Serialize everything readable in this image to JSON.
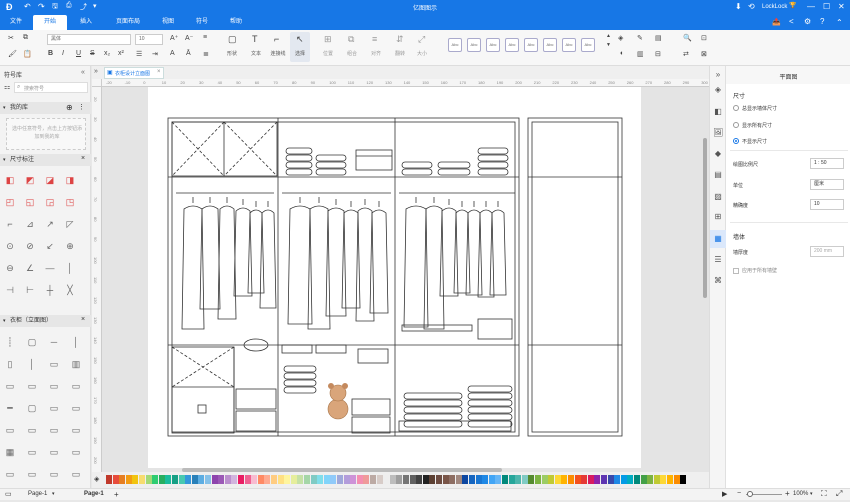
{
  "app": {
    "title": "亿图图示",
    "logo_glyph": "Ð",
    "quick": {
      "undo": "↶",
      "redo": "↷",
      "save": "🖫",
      "print": "⎙",
      "export": "⤴",
      "more": "▾"
    },
    "top_right": {
      "download": "⬇",
      "share": "⟲",
      "user_label": "LockLock",
      "gift": "🏆",
      "min": "—",
      "max": "☐",
      "close": "✕"
    }
  },
  "menu": {
    "items": [
      "文件",
      "开始",
      "插入",
      "页面布局",
      "视图",
      "符号",
      "帮助"
    ],
    "active_index": 1,
    "right_icons": {
      "publish": "📤",
      "share": "<",
      "settings": "⚙",
      "help": "?",
      "collapse": "⌃"
    }
  },
  "ribbon": {
    "font": "黑体",
    "size": "10",
    "tools": [
      {
        "label": "形状",
        "icon": "▢"
      },
      {
        "label": "文本",
        "icon": "T"
      },
      {
        "label": "连接线",
        "icon": "⌐"
      },
      {
        "label": "选择",
        "icon": "↖"
      }
    ],
    "tools2": [
      {
        "label": "位置",
        "icon": "⊞"
      },
      {
        "label": "组合",
        "icon": "⧉"
      },
      {
        "label": "对齐",
        "icon": "≡"
      },
      {
        "label": "翻转",
        "icon": "⇵"
      },
      {
        "label": "大小",
        "icon": "⤢"
      }
    ],
    "style_label": "Abc",
    "style_count": 8
  },
  "library": {
    "title": "符号库",
    "search_placeholder": "搜索符号",
    "my_library": "我的库",
    "my_library_hint": "选中任意符号，点击上方按钮添加到我的库",
    "section1": "尺寸标注",
    "section2": "衣柜（立面图）"
  },
  "canvas": {
    "tab": "衣柜设计立面图",
    "ruler_top": [
      "-20",
      "-10",
      "0",
      "10",
      "20",
      "30",
      "40",
      "50",
      "60",
      "70",
      "80",
      "90",
      "100",
      "110",
      "120",
      "130",
      "140",
      "150",
      "160",
      "170",
      "180",
      "190",
      "200",
      "210",
      "220",
      "230",
      "240",
      "250",
      "260",
      "270",
      "280",
      "290",
      "300"
    ],
    "ruler_left": [
      "20",
      "30",
      "40",
      "50",
      "60",
      "70",
      "80",
      "90",
      "100",
      "110",
      "120",
      "130",
      "140",
      "150",
      "160",
      "170",
      "180",
      "190",
      "200"
    ]
  },
  "panel": {
    "title": "平面图",
    "section_dim": "尺寸",
    "options": [
      "总显示墙体尺寸",
      "显示所有尺寸",
      "不显示尺寸"
    ],
    "selected_option": 2,
    "scale_label": "绘图比例尺",
    "scale_value": "1 : 50",
    "unit_label": "单位",
    "unit_value": "厘米",
    "precision_label": "精确度",
    "precision_value": "10",
    "wall_section": "墙体",
    "wall_thickness_label": "墙厚度",
    "wall_thickness_value": "200 mm",
    "apply_all": "应用于所有墙壁"
  },
  "palette": {
    "colors": [
      "#c0392b",
      "#e74c3c",
      "#e67e22",
      "#f39c12",
      "#f1c40f",
      "#f7dc6f",
      "#a3d977",
      "#2ecc71",
      "#27ae60",
      "#1abc9c",
      "#16a085",
      "#48c9b0",
      "#3498db",
      "#2980b9",
      "#5dade2",
      "#85c1e9",
      "#8e44ad",
      "#9b59b6",
      "#bb8fce",
      "#d2b4de",
      "#e91e63",
      "#f06292",
      "#f8bbd0",
      "#ff8a65",
      "#ffab91",
      "#ffcc80",
      "#ffe082",
      "#fff59d",
      "#e6ee9c",
      "#c5e1a5",
      "#a5d6a7",
      "#80cbc4",
      "#80deea",
      "#81d4fa",
      "#90caf9",
      "#9fa8da",
      "#b39ddb",
      "#ce93d8",
      "#f48fb1",
      "#ef9a9a",
      "#bcaaa4",
      "#d7ccc8",
      "#eeeeee",
      "#bdbdbd",
      "#9e9e9e",
      "#757575",
      "#616161",
      "#424242",
      "#212121",
      "#5c4033",
      "#6d4c41",
      "#795548",
      "#8d6e63",
      "#a1887f",
      "#0d47a1",
      "#1565c0",
      "#1976d2",
      "#1e88e5",
      "#42a5f5",
      "#64b5f6",
      "#00897b",
      "#26a69a",
      "#4db6ac",
      "#80cbc4",
      "#558b2f",
      "#7cb342",
      "#9ccc65",
      "#c0ca33",
      "#fdd835",
      "#ffb300",
      "#fb8c00",
      "#f4511e",
      "#e53935",
      "#d81b60",
      "#8e24aa",
      "#5e35b1",
      "#3949ab",
      "#1e88e5",
      "#039be5",
      "#00acc1",
      "#00897b",
      "#43a047",
      "#7cb342",
      "#c0ca33",
      "#fdd835",
      "#ffb300",
      "#fb8c00",
      "#000000"
    ]
  },
  "status": {
    "page_select": "Page-1",
    "page_tab": "Page-1",
    "add": "+",
    "zoom": "100%",
    "zoom_minus": "−",
    "zoom_plus": "+",
    "fit": "⛶",
    "fullscreen": "⤢"
  }
}
